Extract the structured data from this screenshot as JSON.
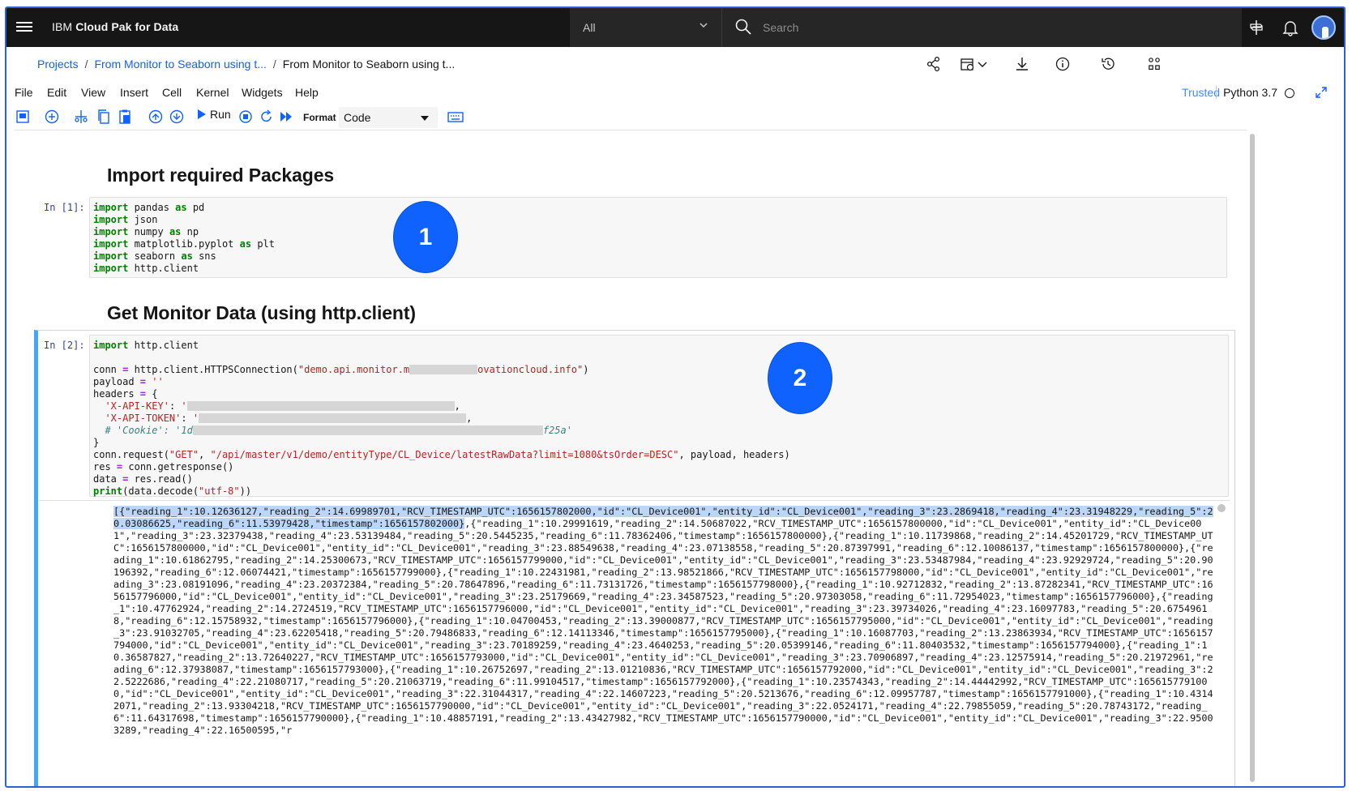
{
  "topbar": {
    "brand_prefix": "IBM",
    "brand_name": "Cloud Pak for Data",
    "scope_value": "All",
    "search_placeholder": "Search"
  },
  "breadcrumb": {
    "items": [
      "Projects",
      "From Monitor to Seaborn using t...",
      "From Monitor to Seaborn using t..."
    ]
  },
  "menu": {
    "items": [
      "File",
      "Edit",
      "View",
      "Insert",
      "Cell",
      "Kernel",
      "Widgets",
      "Help"
    ],
    "trusted": "Trusted",
    "kernel": "Python 3.7"
  },
  "toolbar": {
    "run_label": "Run",
    "format_label": "Format",
    "format_value": "Code"
  },
  "notebook": {
    "heading1": "Import required Packages",
    "heading2": "Get Monitor Data (using http.client)",
    "cell1_prompt": "In [1]:",
    "cell2_prompt": "In [2]:",
    "badge1": "1",
    "badge2": "2",
    "output_highlight": "[{\"reading_1\":10.12636127,\"reading_2\":14.69989701,\"RCV_TIMESTAMP_UTC\":1656157802000,\"id\":\"CL_Device001\",\"entity_id\":\"CL_Device001\",\"reading_3\":23.2869418,\"reading_4\":23.31948229,\"reading_5\":20.03086625,\"reading_6\":11.53979428,\"timestamp\":1656157802000}",
    "output_rest": ",{\"reading_1\":10.29991619,\"reading_2\":14.50687022,\"RCV_TIMESTAMP_UTC\":1656157800000,\"id\":\"CL_Device001\",\"entity_id\":\"CL_Device001\",\"reading_3\":23.32379438,\"reading_4\":23.53139484,\"reading_5\":20.5445235,\"reading_6\":11.78362406,\"timestamp\":1656157800000},{\"reading_1\":10.11739868,\"reading_2\":14.45201729,\"RCV_TIMESTAMP_UTC\":1656157800000,\"id\":\"CL_Device001\",\"entity_id\":\"CL_Device001\",\"reading_3\":23.88549638,\"reading_4\":23.07138558,\"reading_5\":20.87397991,\"reading_6\":12.10086137,\"timestamp\":1656157800000},{\"reading_1\":10.61862795,\"reading_2\":14.25300673,\"RCV_TIMESTAMP_UTC\":1656157799000,\"id\":\"CL_Device001\",\"entity_id\":\"CL_Device001\",\"reading_3\":23.53487984,\"reading_4\":23.92929724,\"reading_5\":20.90196392,\"reading_6\":12.06074421,\"timestamp\":1656157799000},{\"reading_1\":10.22431981,\"reading_2\":13.98521866,\"RCV_TIMESTAMP_UTC\":1656157798000,\"id\":\"CL_Device001\",\"entity_id\":\"CL_Device001\",\"reading_3\":23.08191096,\"reading_4\":23.20372384,\"reading_5\":20.78647896,\"reading_6\":11.73131726,\"timestamp\":1656157798000},{\"reading_1\":10.92712832,\"reading_2\":13.87282341,\"RCV_TIMESTAMP_UTC\":1656157796000,\"id\":\"CL_Device001\",\"entity_id\":\"CL_Device001\",\"reading_3\":23.25179669,\"reading_4\":23.34587523,\"reading_5\":20.97303058,\"reading_6\":11.72954023,\"timestamp\":1656157796000},{\"reading_1\":10.47762924,\"reading_2\":14.2724519,\"RCV_TIMESTAMP_UTC\":1656157796000,\"id\":\"CL_Device001\",\"entity_id\":\"CL_Device001\",\"reading_3\":23.39734026,\"reading_4\":23.16097783,\"reading_5\":20.67549618,\"reading_6\":12.15758932,\"timestamp\":1656157796000},{\"reading_1\":10.04700453,\"reading_2\":13.39000877,\"RCV_TIMESTAMP_UTC\":1656157795000,\"id\":\"CL_Device001\",\"entity_id\":\"CL_Device001\",\"reading_3\":23.91032705,\"reading_4\":23.62205418,\"reading_5\":20.79486833,\"reading_6\":12.14113346,\"timestamp\":1656157795000},{\"reading_1\":10.16087703,\"reading_2\":13.23863934,\"RCV_TIMESTAMP_UTC\":1656157794000,\"id\":\"CL_Device001\",\"entity_id\":\"CL_Device001\",\"reading_3\":23.70189259,\"reading_4\":23.4640253,\"reading_5\":20.05399146,\"reading_6\":11.80403532,\"timestamp\":1656157794000},{\"reading_1\":10.36587827,\"reading_2\":13.72640227,\"RCV_TIMESTAMP_UTC\":1656157793000,\"id\":\"CL_Device001\",\"entity_id\":\"CL_Device001\",\"reading_3\":23.70906897,\"reading_4\":23.12575914,\"reading_5\":20.21972961,\"reading_6\":12.37938087,\"timestamp\":1656157793000},{\"reading_1\":10.26752697,\"reading_2\":13.01210836,\"RCV_TIMESTAMP_UTC\":1656157792000,\"id\":\"CL_Device001\",\"entity_id\":\"CL_Device001\",\"reading_3\":22.5222686,\"reading_4\":22.21080717,\"reading_5\":20.21063719,\"reading_6\":11.99104517,\"timestamp\":1656157792000},{\"reading_1\":10.23574343,\"reading_2\":14.44442992,\"RCV_TIMESTAMP_UTC\":1656157791000,\"id\":\"CL_Device001\",\"entity_id\":\"CL_Device001\",\"reading_3\":22.31044317,\"reading_4\":22.14607223,\"reading_5\":20.5213676,\"reading_6\":12.09957787,\"timestamp\":1656157791000},{\"reading_1\":10.43142071,\"reading_2\":13.93304218,\"RCV_TIMESTAMP_UTC\":1656157790000,\"id\":\"CL_Device001\",\"entity_id\":\"CL_Device001\",\"reading_3\":22.0524171,\"reading_4\":22.79855059,\"reading_5\":20.78743172,\"reading_6\":11.64317698,\"timestamp\":1656157790000},{\"reading_1\":10.48857191,\"reading_2\":13.43427982,\"RCV_TIMESTAMP_UTC\":1656157790000,\"id\":\"CL_Device001\",\"entity_id\":\"CL_Device001\",\"reading_3\":22.95003289,\"reading_4\":22.16500595,\"r"
  }
}
